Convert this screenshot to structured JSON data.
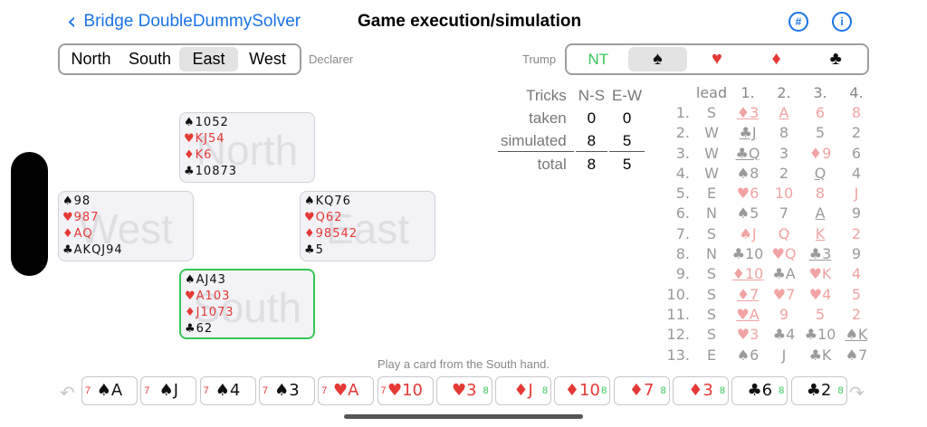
{
  "nav": {
    "back_label": "Bridge DoubleDummySolver",
    "title": "Game execution/simulation",
    "hash_icon": "#",
    "info_icon": "i"
  },
  "declarer": {
    "options": [
      "North",
      "South",
      "East",
      "West"
    ],
    "selected": "East",
    "label": "Declarer"
  },
  "trump": {
    "label": "Trump",
    "options": [
      "NT",
      "♠",
      "♥",
      "♦",
      "♣"
    ],
    "selected": "♠",
    "colors": {
      "NT": "#34c759",
      "♥": "#e53935",
      "♦": "#e53935",
      "♠": "#111111",
      "♣": "#111111"
    }
  },
  "hands": {
    "north": {
      "name": "North",
      "spades": "♠1052",
      "hearts": "♥KJ54",
      "diamonds": "♦K6",
      "clubs": "♣10873"
    },
    "west": {
      "name": "West",
      "spades": "♠98",
      "hearts": "♥987",
      "diamonds": "♦AQ",
      "clubs": "♣AKQJ94"
    },
    "east": {
      "name": "East",
      "spades": "♠KQ76",
      "hearts": "♥Q62",
      "diamonds": "♦98542",
      "clubs": "♣5"
    },
    "south": {
      "name": "South",
      "spades": "♠AJ43",
      "hearts": "♥A103",
      "diamonds": "♦J1073",
      "clubs": "♣62"
    }
  },
  "tricks": {
    "header": [
      "Tricks",
      "N-S",
      "E-W"
    ],
    "taken": {
      "label": "taken",
      "ns": "0",
      "ew": "0"
    },
    "simulated": {
      "label": "simulated",
      "ns": "8",
      "ew": "5"
    },
    "total": {
      "label": "total",
      "ns": "8",
      "ew": "5"
    }
  },
  "plays": {
    "header": [
      "lead",
      "1.",
      "2.",
      "3.",
      "4."
    ],
    "rows": [
      {
        "no": "1.",
        "lead": "S",
        "cards": [
          [
            "♦3",
            "r",
            "u"
          ],
          [
            "A",
            "r",
            "u"
          ],
          [
            "6",
            "r",
            ""
          ],
          [
            "8",
            "r",
            ""
          ]
        ]
      },
      {
        "no": "2.",
        "lead": "W",
        "cards": [
          [
            "♣J",
            "b",
            "u"
          ],
          [
            "8",
            "b",
            ""
          ],
          [
            "5",
            "b",
            ""
          ],
          [
            "2",
            "b",
            ""
          ]
        ]
      },
      {
        "no": "3.",
        "lead": "W",
        "cards": [
          [
            "♣Q",
            "b",
            "u"
          ],
          [
            "3",
            "b",
            ""
          ],
          [
            "♦9",
            "r",
            ""
          ],
          [
            "6",
            "b",
            ""
          ]
        ]
      },
      {
        "no": "4.",
        "lead": "W",
        "cards": [
          [
            "♠8",
            "b",
            ""
          ],
          [
            "2",
            "b",
            ""
          ],
          [
            "Q",
            "b",
            "u"
          ],
          [
            "4",
            "b",
            ""
          ]
        ]
      },
      {
        "no": "5.",
        "lead": "E",
        "cards": [
          [
            "♥6",
            "r",
            ""
          ],
          [
            "10",
            "r",
            ""
          ],
          [
            "8",
            "r",
            ""
          ],
          [
            "J",
            "r",
            "u"
          ]
        ]
      },
      {
        "no": "6.",
        "lead": "N",
        "cards": [
          [
            "♠5",
            "b",
            ""
          ],
          [
            "7",
            "b",
            ""
          ],
          [
            "A",
            "b",
            "u"
          ],
          [
            "9",
            "b",
            ""
          ]
        ]
      },
      {
        "no": "7.",
        "lead": "S",
        "cards": [
          [
            "♠J",
            "r",
            ""
          ],
          [
            "Q",
            "r",
            ""
          ],
          [
            "K",
            "r",
            "u"
          ],
          [
            "2",
            "r",
            ""
          ]
        ]
      },
      {
        "no": "8.",
        "lead": "N",
        "cards": [
          [
            "♣10",
            "b",
            ""
          ],
          [
            "♥Q",
            "r",
            ""
          ],
          [
            "♣3",
            "b",
            "u"
          ],
          [
            "9",
            "b",
            ""
          ]
        ]
      },
      {
        "no": "9.",
        "lead": "S",
        "cards": [
          [
            "♦10",
            "r",
            "u"
          ],
          [
            "♣A",
            "b",
            ""
          ],
          [
            "♥K",
            "r",
            ""
          ],
          [
            "4",
            "r",
            ""
          ]
        ]
      },
      {
        "no": "10.",
        "lead": "S",
        "cards": [
          [
            "♦7",
            "r",
            "u"
          ],
          [
            "♥7",
            "r",
            ""
          ],
          [
            "♥4",
            "r",
            ""
          ],
          [
            "5",
            "r",
            ""
          ]
        ]
      },
      {
        "no": "11.",
        "lead": "S",
        "cards": [
          [
            "♥A",
            "r",
            "u"
          ],
          [
            "9",
            "r",
            ""
          ],
          [
            "5",
            "r",
            ""
          ],
          [
            "2",
            "r",
            ""
          ]
        ]
      },
      {
        "no": "12.",
        "lead": "S",
        "cards": [
          [
            "♥3",
            "r",
            ""
          ],
          [
            "♣4",
            "b",
            ""
          ],
          [
            "♣10",
            "b",
            ""
          ],
          [
            "♠K",
            "b",
            "u"
          ]
        ]
      },
      {
        "no": "13.",
        "lead": "E",
        "cards": [
          [
            "♠6",
            "b",
            ""
          ],
          [
            "J",
            "b",
            "u"
          ],
          [
            "♣K",
            "b",
            ""
          ],
          [
            "♠7",
            "b",
            ""
          ]
        ]
      }
    ]
  },
  "hint": "Play a card from the South hand.",
  "cards": [
    {
      "face": "♠A",
      "suit": "b",
      "left": "7",
      "right": ""
    },
    {
      "face": "♠J",
      "suit": "b",
      "left": "7",
      "right": ""
    },
    {
      "face": "♠4",
      "suit": "b",
      "left": "7",
      "right": ""
    },
    {
      "face": "♠3",
      "suit": "b",
      "left": "7",
      "right": ""
    },
    {
      "face": "♥A",
      "suit": "r",
      "left": "7",
      "right": ""
    },
    {
      "face": "♥10",
      "suit": "r",
      "left": "7",
      "right": ""
    },
    {
      "face": "♥3",
      "suit": "r",
      "left": "",
      "right": "8"
    },
    {
      "face": "♦J",
      "suit": "r",
      "left": "",
      "right": "8"
    },
    {
      "face": "♦10",
      "suit": "r",
      "left": "",
      "right": "8"
    },
    {
      "face": "♦7",
      "suit": "r",
      "left": "",
      "right": "8"
    },
    {
      "face": "♦3",
      "suit": "r",
      "left": "",
      "right": "8"
    },
    {
      "face": "♣6",
      "suit": "b",
      "left": "",
      "right": "8"
    },
    {
      "face": "♣2",
      "suit": "b",
      "left": "",
      "right": "8"
    }
  ],
  "undo_icon": "↶",
  "redo_icon": "↷"
}
